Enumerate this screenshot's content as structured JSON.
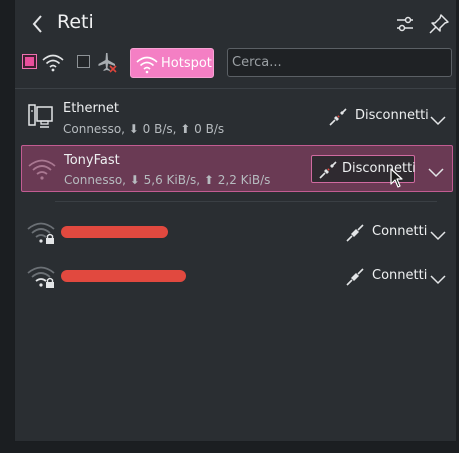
{
  "header": {
    "title": "Reti",
    "back_icon": "back-arrow-icon",
    "configure_icon": "sliders-icon",
    "pin_icon": "pin-icon"
  },
  "toolbar": {
    "wifi_checkbox_checked": true,
    "airplane_checkbox_checked": false,
    "hotspot_label": "Hotspot",
    "search_placeholder": "Cerca...",
    "search_value": ""
  },
  "connections": [
    {
      "name": "Ethernet",
      "status": "Connesso, ⬇ 0 B/s, ⬆ 0 B/s",
      "action_label": "Disconnetti",
      "icon": "ethernet-icon",
      "connected": true,
      "selected": false
    },
    {
      "name": "TonyFast",
      "status": "Connesso, ⬇ 5,6 KiB/s, ⬆ 2,2 KiB/s",
      "action_label": "Disconnetti",
      "icon": "wifi-icon",
      "connected": true,
      "selected": true
    },
    {
      "name": "",
      "status": "",
      "action_label": "Connetti",
      "icon": "wifi-locked-icon",
      "connected": false,
      "selected": false,
      "redacted": true
    },
    {
      "name": "",
      "status": "",
      "action_label": "Connetti",
      "icon": "wifi-locked-icon",
      "connected": false,
      "selected": false,
      "redacted": true
    }
  ],
  "colors": {
    "accent": "#e94e9b",
    "hotspot": "#f47fc4",
    "selection": "#6a3a54",
    "redaction": "#e1493f"
  }
}
